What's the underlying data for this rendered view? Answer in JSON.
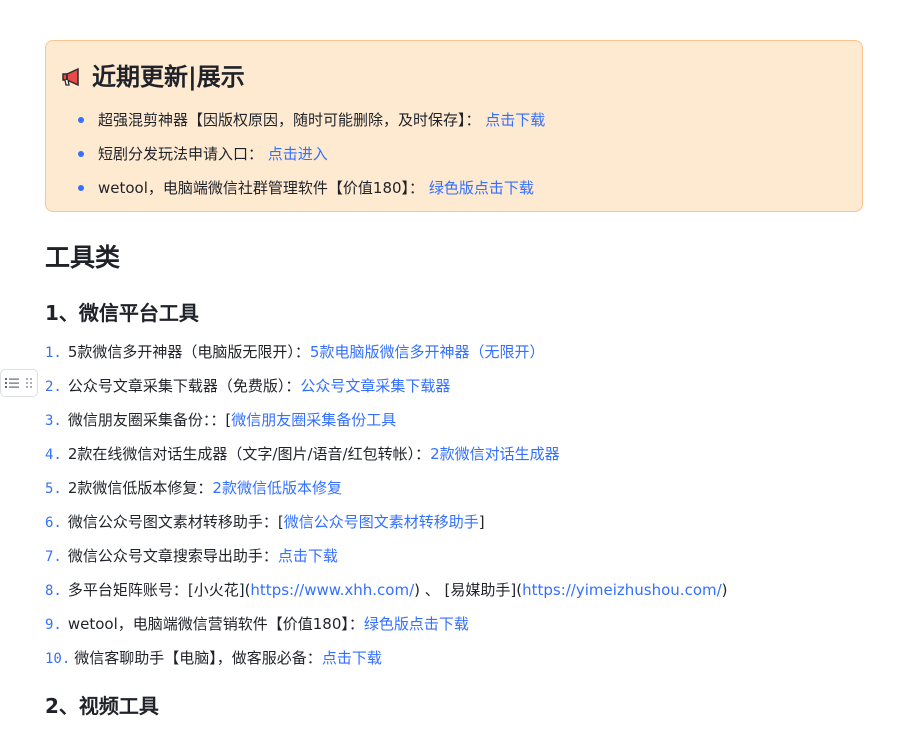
{
  "callout": {
    "icon": "megaphone-icon",
    "title": "近期更新|展示",
    "items": [
      {
        "text": "超强混剪神器【因版权原因，随时可能删除，及时保存】：",
        "link": "点击下载"
      },
      {
        "text": "短剧分发玩法申请入口：",
        "link": "点击进入"
      },
      {
        "text": "wetool，电脑端微信社群管理软件【价值180】：",
        "link": "绿色版点击下载"
      }
    ],
    "colors": {
      "background": "#fee9d1",
      "border": "#f8c590",
      "bullet": "#3370ff"
    }
  },
  "section_title": "工具类",
  "subsection1": "1、微信平台工具",
  "list": [
    {
      "num": "1.",
      "text": "5款微信多开神器（电脑版无限开）：",
      "link": "5款电脑版微信多开神器（无限开）",
      "after": ""
    },
    {
      "num": "2.",
      "text": "公众号文章采集下载器（免费版）：",
      "link": "公众号文章采集下载器",
      "after": ""
    },
    {
      "num": "3.",
      "text": "微信朋友圈采集备份：：[",
      "link": "微信朋友圈采集备份工具",
      "after": ""
    },
    {
      "num": "4.",
      "text": "2款在线微信对话生成器（文字/图片/语音/红包转帐）：",
      "link": "2款微信对话生成器",
      "after": ""
    },
    {
      "num": "5.",
      "text": "2款微信低版本修复：",
      "link": "2款微信低版本修复",
      "after": ""
    },
    {
      "num": "6.",
      "text": "微信公众号图文素材转移助手：[",
      "link": "微信公众号图文素材转移助手",
      "after": "]"
    },
    {
      "num": "7.",
      "text": "微信公众号文章搜索导出助手：",
      "link": "点击下载",
      "after": ""
    },
    {
      "num": "8.",
      "text": "多平台矩阵账号：[小火花](",
      "link": "https://www.xhh.com/",
      "after": ") 、 [易媒助手](",
      "link2": "https://yimeizhushou.com/",
      "after2": ")"
    },
    {
      "num": "9.",
      "text": "wetool，电脑端微信营销软件【价值180】：",
      "link": "绿色版点击下载",
      "after": ""
    },
    {
      "num": "10.",
      "text": "微信客聊助手【电脑】，做客服必备：",
      "link": "点击下载",
      "after": ""
    }
  ],
  "subsection2": "2、视频工具",
  "handle": {
    "icons": [
      "list-format-icon",
      "drag-handle-icon"
    ]
  },
  "link_color": "#3370ff"
}
